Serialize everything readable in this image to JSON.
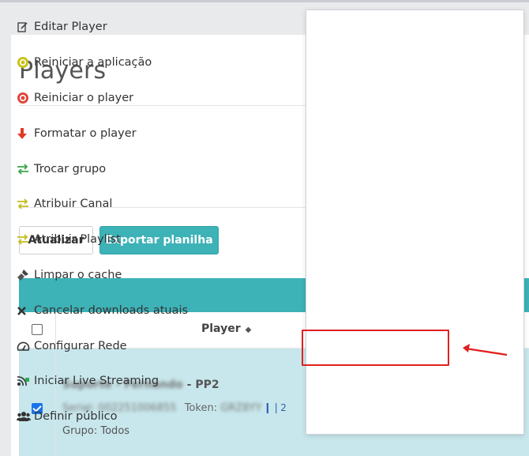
{
  "page": {
    "title": "Players"
  },
  "toolbar": {
    "refresh_label": "Atualizar",
    "export_label": "Exportar planilha"
  },
  "table": {
    "header": {
      "player_label": "Player",
      "sort_icon": "sort-icon"
    },
    "rows": [
      {
        "name_blurred": "Suporte - Fernando",
        "name_suffix": "- PP2",
        "serial_blurred": "Serial: 002251006855",
        "token_label": "Token:",
        "token_blurred": "GRZ8YY",
        "token_badge": "2",
        "group": "Grupo: Todos",
        "checked": true
      }
    ]
  },
  "menu": {
    "items": [
      {
        "label": "Editar Player",
        "icon": "edit-icon"
      },
      {
        "label": "Reiniciar a aplicação",
        "icon": "restart-app-icon"
      },
      {
        "label": "Reiniciar o player",
        "icon": "restart-player-icon"
      },
      {
        "label": "Formatar o player",
        "icon": "format-arrow-down-icon"
      },
      {
        "label": "Trocar grupo",
        "icon": "swap-group-icon"
      },
      {
        "label": "Atribuir Canal",
        "icon": "swap-channel-icon"
      },
      {
        "label": "Atribuir Playlist",
        "icon": "swap-playlist-icon"
      },
      {
        "label": "Limpar o cache",
        "icon": "clear-cache-icon"
      },
      {
        "label": "Cancelar downloads atuais",
        "icon": "close-icon"
      },
      {
        "label": "Configurar Rede",
        "icon": "dashboard-icon"
      },
      {
        "label": "Iniciar Live Streaming",
        "icon": "live-stream-icon"
      },
      {
        "label": "Definir público",
        "icon": "users-icon"
      }
    ],
    "highlighted_item": "Configurar Rede"
  },
  "colors": {
    "accent": "#3db2b7",
    "row_selected": "#c8e7ec",
    "annotation": "#e02020"
  }
}
